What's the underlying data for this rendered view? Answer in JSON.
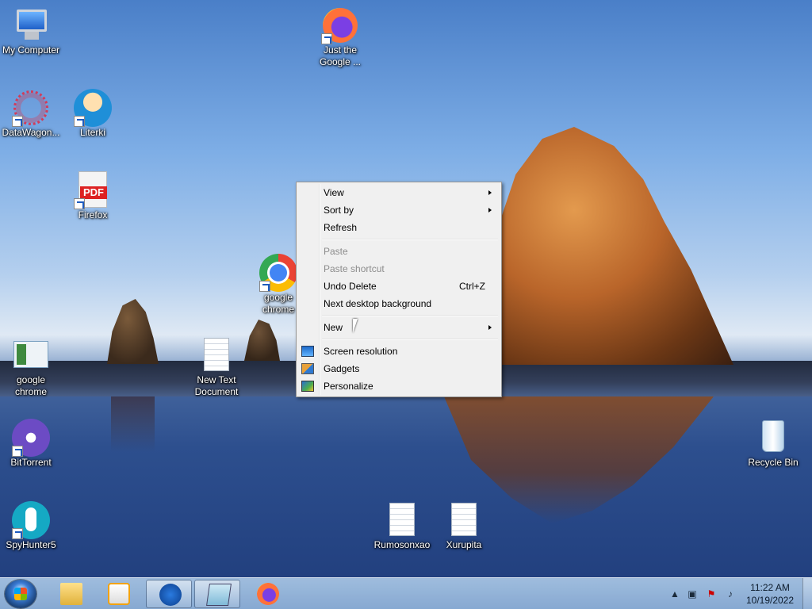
{
  "desktop": {
    "icons": [
      {
        "label": "My Computer",
        "icon": "computer-icon"
      },
      {
        "label": "DataWagon...",
        "icon": "datawagon-icon"
      },
      {
        "label": "Literki",
        "icon": "literki-icon"
      },
      {
        "label": "Firefox",
        "icon": "pdf-icon"
      },
      {
        "label": "google chrome",
        "icon": "chrome-icon"
      },
      {
        "label": "Just the Google ...",
        "icon": "firefox-icon"
      },
      {
        "label": "google chrome",
        "icon": "window-icon"
      },
      {
        "label": "New Text Document",
        "icon": "text-document-icon"
      },
      {
        "label": "BitTorrent",
        "icon": "bittorrent-icon"
      },
      {
        "label": "SpyHunter5",
        "icon": "spyhunter-icon"
      },
      {
        "label": "Rumosonxao",
        "icon": "document-icon"
      },
      {
        "label": "Xurupita",
        "icon": "document-icon"
      },
      {
        "label": "Recycle Bin",
        "icon": "recycle-bin-icon"
      }
    ]
  },
  "context_menu": {
    "view": "View",
    "sort_by": "Sort by",
    "refresh": "Refresh",
    "paste": "Paste",
    "paste_shortcut": "Paste shortcut",
    "undo_delete": "Undo Delete",
    "undo_delete_shortcut": "Ctrl+Z",
    "next_background": "Next desktop background",
    "new": "New",
    "screen_resolution": "Screen resolution",
    "gadgets": "Gadgets",
    "personalize": "Personalize"
  },
  "taskbar": {
    "pinned": [
      "windows-explorer-icon",
      "media-player-icon",
      "lightning-app-icon",
      "notepad-icon",
      "firefox-icon"
    ],
    "tray": {
      "time": "11:22 AM",
      "date": "10/19/2022"
    }
  },
  "colors": {
    "menu_bg": "#f0f0f0",
    "taskbar": "#9fbfe3",
    "disabled_text": "#8d8d8d"
  }
}
